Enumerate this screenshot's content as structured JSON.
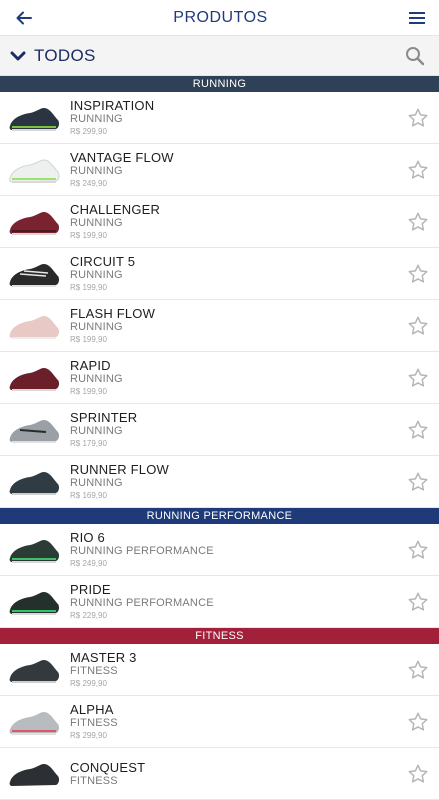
{
  "header": {
    "title": "PRODUTOS"
  },
  "filter": {
    "label": "TODOS"
  },
  "sections": {
    "running": {
      "title": "RUNNING",
      "items": [
        {
          "name": "INSPIRATION",
          "category": "RUNNING",
          "price": "R$ 299,90"
        },
        {
          "name": "VANTAGE FLOW",
          "category": "RUNNING",
          "price": "R$ 249,90"
        },
        {
          "name": "CHALLENGER",
          "category": "RUNNING",
          "price": "R$ 199,90"
        },
        {
          "name": "CIRCUIT 5",
          "category": "RUNNING",
          "price": "R$ 199,90"
        },
        {
          "name": "FLASH FLOW",
          "category": "RUNNING",
          "price": "R$ 199,90"
        },
        {
          "name": "RAPID",
          "category": "RUNNING",
          "price": "R$ 199,90"
        },
        {
          "name": "SPRINTER",
          "category": "RUNNING",
          "price": "R$ 179,90"
        },
        {
          "name": "RUNNER FLOW",
          "category": "RUNNING",
          "price": "R$ 169,90"
        }
      ]
    },
    "performance": {
      "title": "RUNNING PERFORMANCE",
      "items": [
        {
          "name": "RIO 6",
          "category": "RUNNING PERFORMANCE",
          "price": "R$ 249,90"
        },
        {
          "name": "PRIDE",
          "category": "RUNNING PERFORMANCE",
          "price": "R$ 229,90"
        }
      ]
    },
    "fitness": {
      "title": "FITNESS",
      "items": [
        {
          "name": "MASTER 3",
          "category": "FITNESS",
          "price": "R$ 299,90"
        },
        {
          "name": "ALPHA",
          "category": "FITNESS",
          "price": "R$ 299,90"
        },
        {
          "name": "CONQUEST",
          "category": "FITNESS",
          "price": ""
        }
      ]
    }
  },
  "colors": {
    "title": "#1f3b7a",
    "running_header": "#2f4156",
    "performance_header": "#1e3a78",
    "fitness_header": "#a3203a"
  },
  "icons": {
    "back": "arrow-left-icon",
    "menu": "hamburger-menu-icon",
    "filter": "chevron-down-icon",
    "search": "search-icon",
    "favorite": "star-outline-icon"
  }
}
